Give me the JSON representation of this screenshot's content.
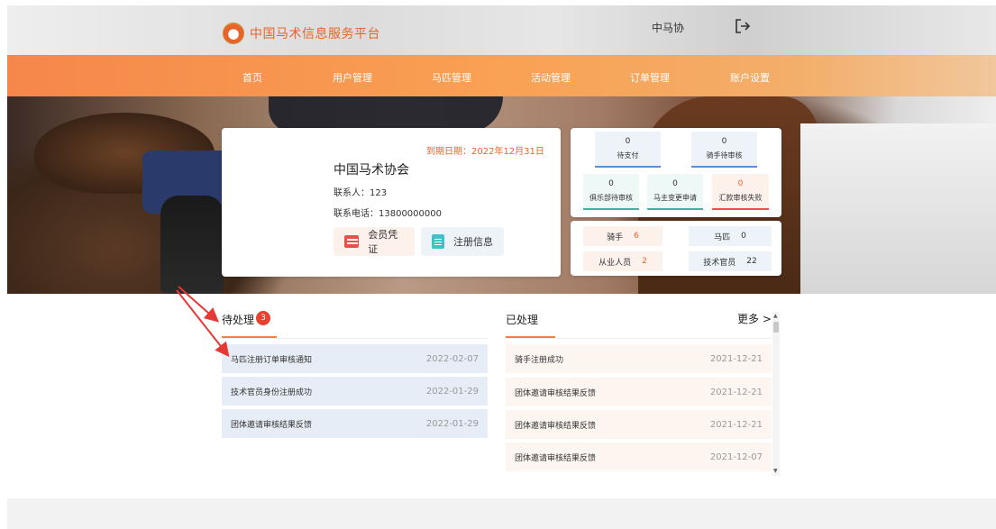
{
  "header": {
    "site_title": "中国马术信息服务平台",
    "org_name": "中马协"
  },
  "nav": {
    "items": [
      "首页",
      "用户管理",
      "马匹管理",
      "活动管理",
      "订单管理",
      "账户设置"
    ]
  },
  "profile": {
    "expiry": "到期日期：2022年12月31日",
    "name": "中国马术协会",
    "contact": "联系人：123",
    "phone": "联系电话：13800000000",
    "member_cert_label": "会员凭证",
    "reg_info_label": "注册信息"
  },
  "stats": {
    "pending_payment": {
      "value": "0",
      "label": "待支付"
    },
    "rider_review": {
      "value": "0",
      "label": "骑手待审核"
    },
    "club_review": {
      "value": "0",
      "label": "俱乐部待审核"
    },
    "owner_change": {
      "value": "0",
      "label": "马主变更申请"
    },
    "remit_failed": {
      "value": "0",
      "label": "汇款审核失败"
    }
  },
  "counts": {
    "riders": {
      "label": "骑手",
      "value": "6"
    },
    "horses": {
      "label": "马匹",
      "value": "0"
    },
    "staff": {
      "label": "从业人员",
      "value": "2"
    },
    "officials": {
      "label": "技术官员",
      "value": "22"
    }
  },
  "pending": {
    "title": "待处理",
    "badge": "3",
    "items": [
      {
        "title": "马匹注册订单审核通知",
        "date": "2022-02-07"
      },
      {
        "title": "技术官员身份注册成功",
        "date": "2022-01-29"
      },
      {
        "title": "团体邀请审核结果反馈",
        "date": "2022-01-29"
      }
    ]
  },
  "processed": {
    "title": "已处理",
    "more": "更多 >",
    "items": [
      {
        "title": "骑手注册成功",
        "date": "2021-12-21"
      },
      {
        "title": "团体邀请审核结果反馈",
        "date": "2021-12-21"
      },
      {
        "title": "团体邀请审核结果反馈",
        "date": "2021-12-21"
      },
      {
        "title": "团体邀请审核结果反馈",
        "date": "2021-12-07"
      }
    ]
  },
  "colors": {
    "accent": "#f1823f",
    "badge": "#e8412f",
    "annotation_arrow": "#e53935"
  }
}
